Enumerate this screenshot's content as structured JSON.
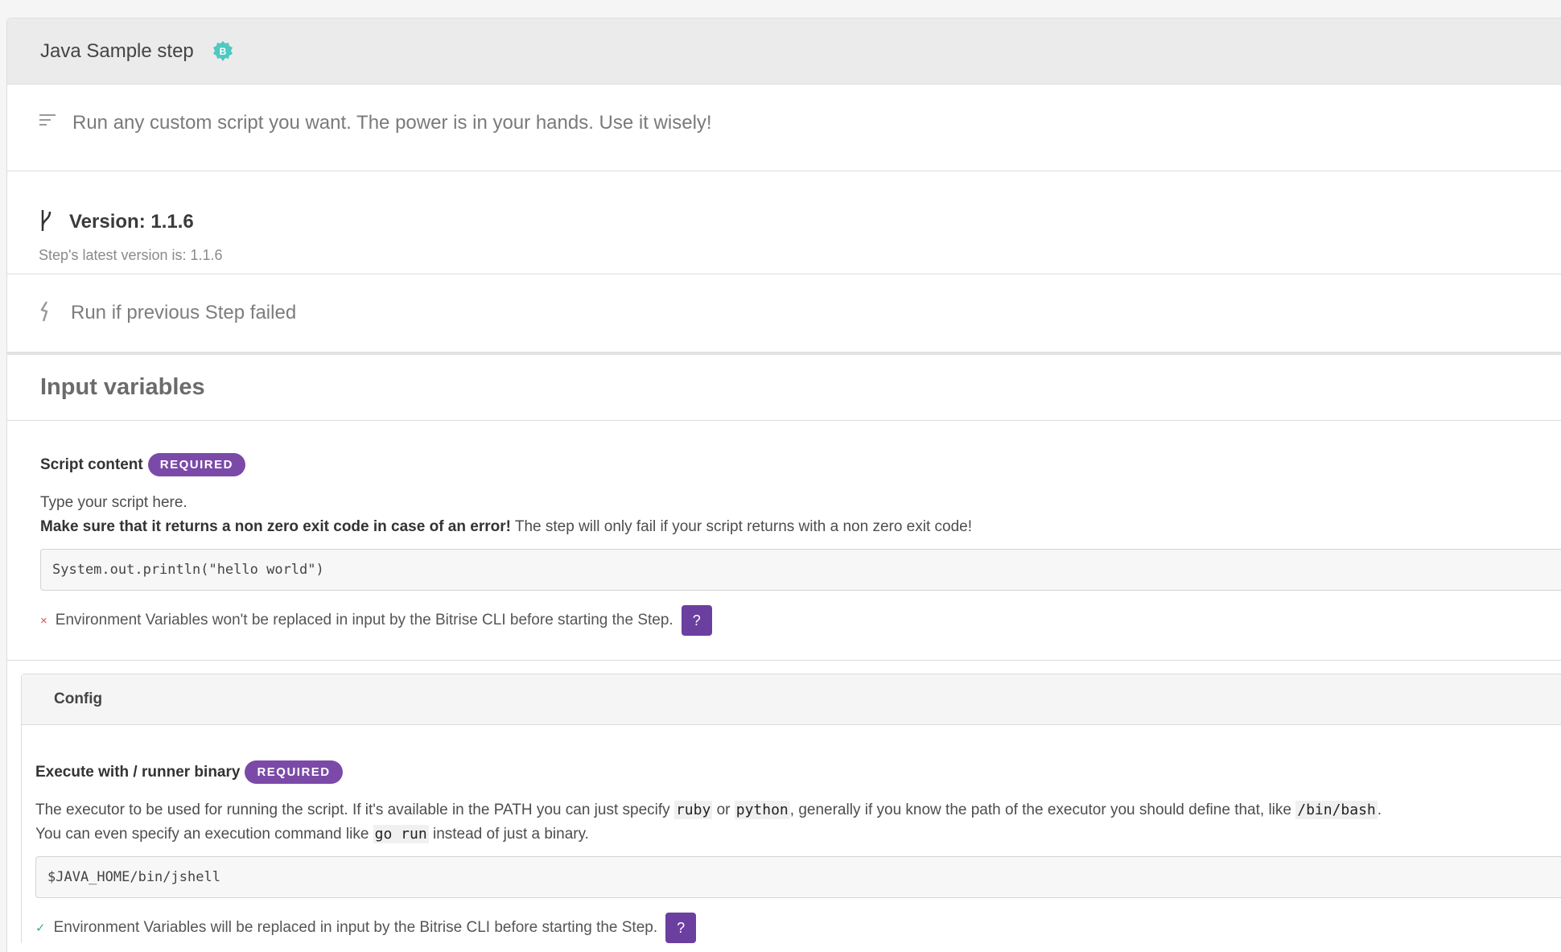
{
  "header": {
    "title": "Java Sample step",
    "badge_letter": "B"
  },
  "description": {
    "text": "Run any custom script you want. The power is in your hands. Use it wisely!"
  },
  "version": {
    "label": "Version: 1.1.6",
    "latest": "Step's latest version is: 1.1.6"
  },
  "run_if": {
    "text": "Run if previous Step failed"
  },
  "input_variables": {
    "title": "Input variables",
    "script": {
      "label": "Script content",
      "badge": "REQUIRED",
      "help_line1": "Type your script here.",
      "help_bold": "Make sure that it returns a non zero exit code in case of an error!",
      "help_rest": " The step will only fail if your script returns with a non zero exit code!",
      "value": "System.out.println(\"hello world\")",
      "env_mark": "×",
      "env_text": "Environment Variables won't be replaced in input by the Bitrise CLI before starting the Step.",
      "help_button": "?"
    }
  },
  "config": {
    "title": "Config",
    "runner": {
      "label": "Execute with / runner binary",
      "badge": "REQUIRED",
      "help_p1": "The executor to be used for running the script. If it's available in the PATH you can just specify ",
      "code_ruby": "ruby",
      "help_or": " or ",
      "code_python": "python",
      "help_p2": ", generally if you know the path of the executor you should define that, like ",
      "code_bash": "/bin/bash",
      "help_p3": ".",
      "help_p4": "You can even specify an execution command like ",
      "code_gorun": "go run",
      "help_p5": " instead of just a binary.",
      "value": "$JAVA_HOME/bin/jshell",
      "env_mark": "✓",
      "env_text": "Environment Variables will be replaced in input by the Bitrise CLI before starting the Step.",
      "help_button": "?"
    }
  },
  "colors": {
    "accent_purple": "#6b3fa0",
    "badge_teal": "#4ec9c0",
    "error_red": "#d9534f",
    "ok_green": "#3fae7a"
  }
}
